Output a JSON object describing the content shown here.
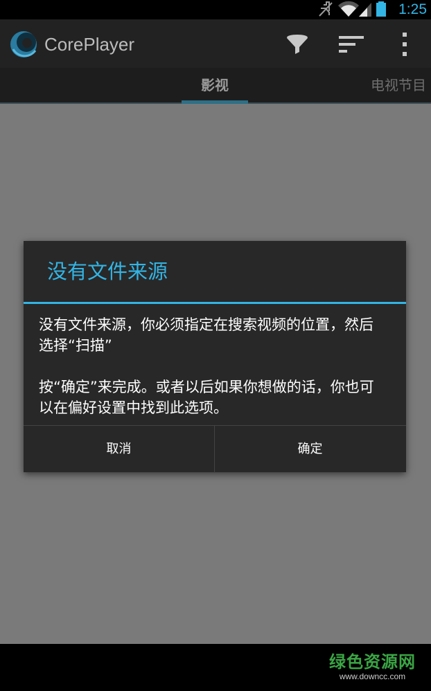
{
  "status_bar": {
    "time": "1:25",
    "icons": [
      "mute-icon",
      "wifi-icon",
      "signal-icon",
      "battery-icon"
    ]
  },
  "action_bar": {
    "app_title": "CorePlayer",
    "icons": [
      "coreplayer-logo-icon",
      "filter-icon",
      "sort-icon",
      "overflow-menu-icon"
    ]
  },
  "tabs": [
    {
      "label": "影视",
      "active": true
    },
    {
      "label": "电视节目",
      "active": false
    }
  ],
  "dialog": {
    "title": "没有文件来源",
    "message_1": "没有文件来源，你必须指定在搜索视频的位置，然后选择“扫描”",
    "message_2": "按“确定”来完成。或者以后如果你想做的话，你也可以在偏好设置中找到此选项。",
    "cancel_label": "取消",
    "ok_label": "确定"
  },
  "watermark": {
    "name": "绿色资源网",
    "url": "www.downcc.com"
  },
  "colors": {
    "accent": "#33b5e5",
    "action_bar_bg": "#222222",
    "dim_overlay": "#7a7a7a",
    "dialog_bg": "#282828",
    "watermark_green": "#3ba544"
  }
}
